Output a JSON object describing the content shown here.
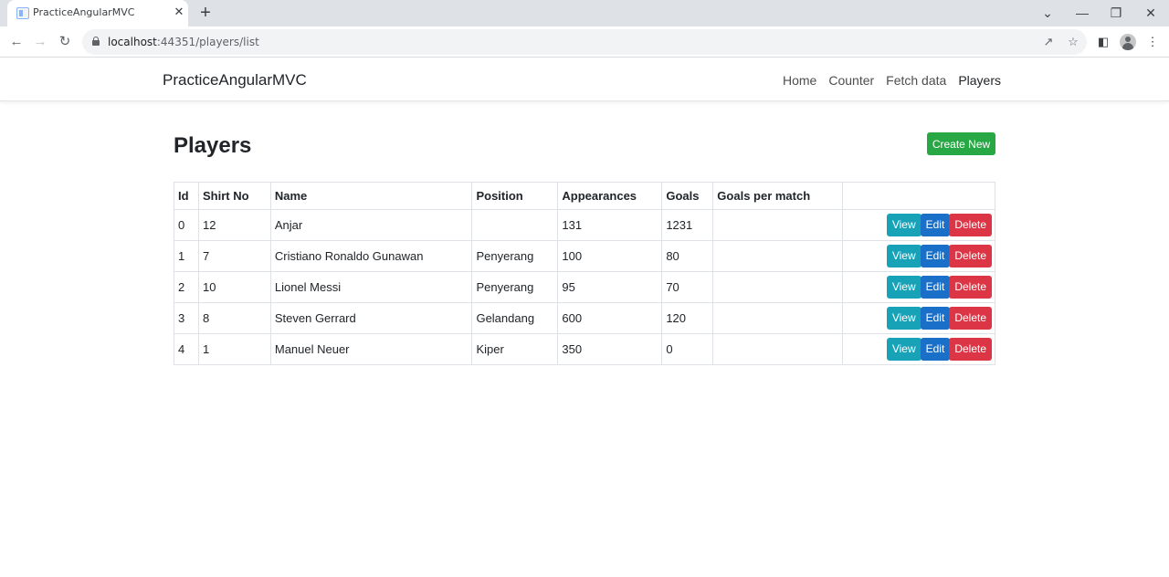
{
  "browser": {
    "tab_title": "PracticeAngularMVC",
    "tab_close": "✕",
    "new_tab": "+",
    "url_host": "localhost",
    "url_rest": ":44351/players/list",
    "controls": {
      "minimize": "—",
      "maximize": "❐",
      "close": "✕",
      "dropdown": "⌄"
    }
  },
  "navbar": {
    "brand": "PracticeAngularMVC",
    "links": [
      "Home",
      "Counter",
      "Fetch data",
      "Players"
    ]
  },
  "page": {
    "title": "Players",
    "create_button": "Create New"
  },
  "table": {
    "headers": [
      "Id",
      "Shirt No",
      "Name",
      "Position",
      "Appearances",
      "Goals",
      "Goals per match",
      ""
    ],
    "rows": [
      {
        "id": "0",
        "shirt_no": "12",
        "name": "Anjar",
        "position": "",
        "appearances": "131",
        "goals": "1231",
        "goals_per_match": ""
      },
      {
        "id": "1",
        "shirt_no": "7",
        "name": "Cristiano Ronaldo Gunawan",
        "position": "Penyerang",
        "appearances": "100",
        "goals": "80",
        "goals_per_match": ""
      },
      {
        "id": "2",
        "shirt_no": "10",
        "name": "Lionel Messi",
        "position": "Penyerang",
        "appearances": "95",
        "goals": "70",
        "goals_per_match": ""
      },
      {
        "id": "3",
        "shirt_no": "8",
        "name": "Steven Gerrard",
        "position": "Gelandang",
        "appearances": "600",
        "goals": "120",
        "goals_per_match": ""
      },
      {
        "id": "4",
        "shirt_no": "1",
        "name": "Manuel Neuer",
        "position": "Kiper",
        "appearances": "350",
        "goals": "0",
        "goals_per_match": ""
      }
    ],
    "actions": {
      "view": "View",
      "edit": "Edit",
      "delete": "Delete"
    }
  },
  "colors": {
    "create": "#28a745",
    "view": "#17a2b8",
    "edit": "#1a6fc8",
    "delete": "#dc3545"
  }
}
